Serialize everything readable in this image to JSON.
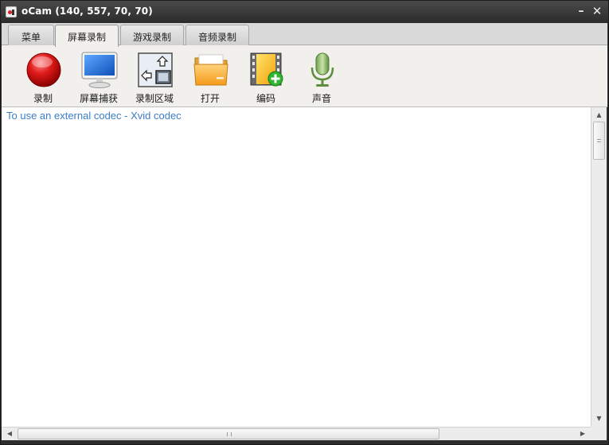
{
  "window": {
    "title": "oCam (140, 557, 70, 70)",
    "minimize_glyph": "–",
    "close_glyph": "✕"
  },
  "tabs": [
    {
      "label": "菜单"
    },
    {
      "label": "屏幕录制",
      "active": true
    },
    {
      "label": "游戏录制"
    },
    {
      "label": "音频录制"
    }
  ],
  "toolbar": {
    "items": [
      {
        "label": "录制",
        "icon": "record-icon"
      },
      {
        "label": "屏幕捕获",
        "icon": "monitor-icon"
      },
      {
        "label": "录制区域",
        "icon": "region-icon"
      },
      {
        "label": "打开",
        "icon": "folder-icon"
      },
      {
        "label": "编码",
        "icon": "film-add-icon"
      },
      {
        "label": "声音",
        "icon": "microphone-icon"
      }
    ]
  },
  "content": {
    "info_link": "To use an external codec - Xvid codec"
  },
  "scrollbars": {
    "up": "▲",
    "down": "▼",
    "left": "◀",
    "right": "▶"
  },
  "colors": {
    "link": "#3b7ec8",
    "titlebar": "#2e2e2e",
    "toolbar_bg": "#f2f0ec"
  }
}
